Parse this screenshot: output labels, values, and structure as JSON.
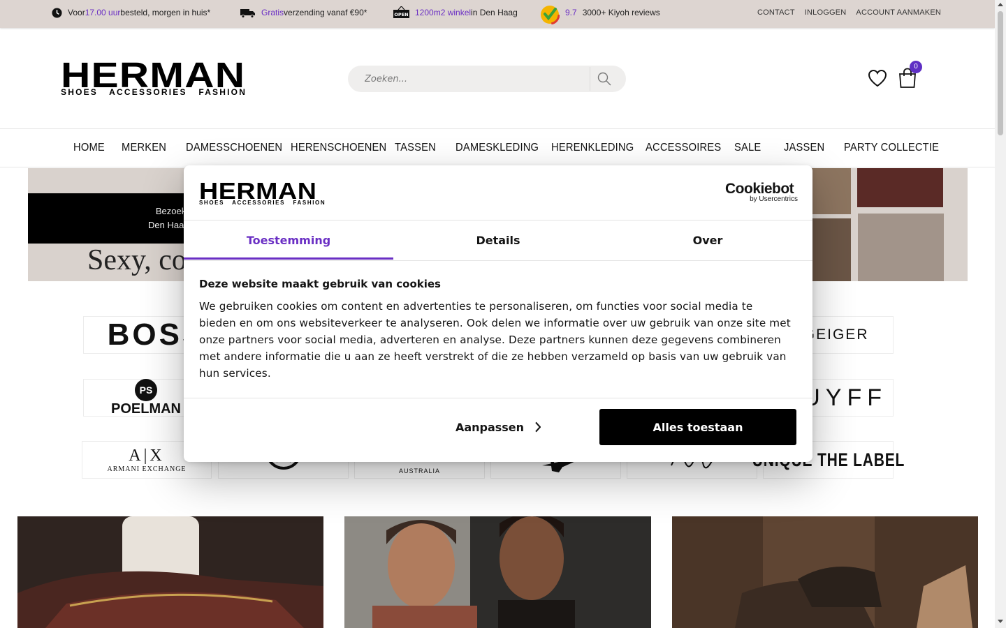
{
  "topbar": {
    "usp1": {
      "pre": "Voor ",
      "hl": "17.00 uur",
      "post": " besteld, morgen in huis*"
    },
    "usp2": {
      "pre": "",
      "hl": "Gratis",
      "post": " verzending vanaf €90*"
    },
    "usp3": {
      "pre": "",
      "hl": "1200m2 winkel",
      "post": " in Den Haag"
    },
    "usp4": {
      "rating": "9.7",
      "text": "3000+ Kiyoh reviews"
    },
    "links": [
      "CONTACT",
      "INLOGGEN",
      "ACCOUNT AANMAKEN"
    ],
    "accent_color": "#6a2fc4"
  },
  "header": {
    "logo_word": "HERMAN",
    "logo_sub": "SHOES   ACCESSORIES   FASHION",
    "search_placeholder": "Zoeken...",
    "cart_count": "0"
  },
  "nav": [
    "HOME",
    "MERKEN",
    "DAMESSCHOENEN",
    "HERENSCHOENEN",
    "TASSEN",
    "DAMESKLEDING",
    "HERENKLEDING",
    "ACCESSOIRES",
    "SALE",
    "JASSEN",
    "PARTY COLLECTIE"
  ],
  "banner": {
    "line1": "Bezoek o",
    "line2": "Den Haag, al",
    "script": "Sexy, co"
  },
  "brands": {
    "boss": "BOSS",
    "geiger": "T GEIGER",
    "ps_mark": "PS",
    "poelman": "POELMAN",
    "cruyff": "UYFF",
    "ax_mark": "A|X",
    "armani": "ARMANI EXCHANGE",
    "wallabi": "AUSTRALIA",
    "unique": "UNIQUE THE LABEL"
  },
  "cookie": {
    "brand_logo_word": "HERMAN",
    "brand_logo_sub": "SHOES   ACCESSORIES   FASHION",
    "cookiebot_main": "Cookiebot",
    "cookiebot_sub": "by Usercentrics",
    "tabs": [
      "Toestemming",
      "Details",
      "Over"
    ],
    "title": "Deze website maakt gebruik van cookies",
    "body": "We gebruiken cookies om content en advertenties te personaliseren, om functies voor social media te bieden en om ons websiteverkeer te analyseren. Ook delen we informatie over uw gebruik van onze site met onze partners voor social media, adverteren en analyse. Deze partners kunnen deze gegevens combineren met andere informatie die u aan ze heeft verstrekt of die ze hebben verzameld op basis van uw gebruik van hun services.",
    "customize_label": "Aanpassen",
    "allow_all_label": "Alles toestaan"
  }
}
